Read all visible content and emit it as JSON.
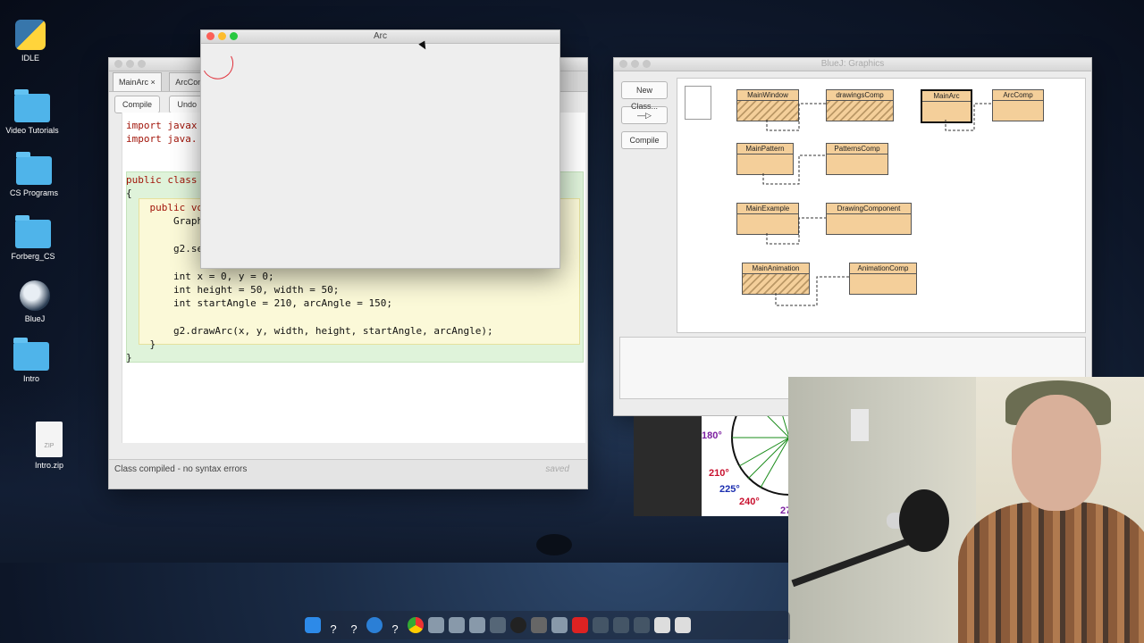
{
  "desktop": {
    "icons": [
      {
        "label": "IDLE"
      },
      {
        "label": "Video Tutorials"
      },
      {
        "label": "CS Programs"
      },
      {
        "label": "Forberg_CS"
      },
      {
        "label": "BlueJ"
      },
      {
        "label": "Intro"
      },
      {
        "label": "Intro.zip"
      }
    ],
    "zip_badge": "ZIP"
  },
  "editor": {
    "tabs": [
      {
        "label": "MainArc",
        "close": "×"
      },
      {
        "label": "ArcComp"
      }
    ],
    "toolbar": {
      "compile": "Compile",
      "undo": "Undo"
    },
    "code": [
      "import javax",
      "import java.",
      "",
      "public class",
      "{",
      "    public voi",
      "        Graphi",
      "",
      "        g2.set",
      "",
      "        int x = 0, y = 0;",
      "        int height = 50, width = 50;",
      "        int startAngle = 210, arcAngle = 150;",
      "",
      "        g2.drawArc(x, y, width, height, startAngle, arcAngle);",
      "    }",
      "}"
    ],
    "status": "Class compiled - no syntax errors",
    "saved": "saved"
  },
  "arc_window": {
    "title": "Arc"
  },
  "bluej": {
    "title": "BlueJ: Graphics",
    "buttons": {
      "new_class": "New Class...",
      "arrow": "—▷",
      "compile": "Compile"
    },
    "classes": [
      {
        "name": "MainWindow"
      },
      {
        "name": "drawingsComp"
      },
      {
        "name": "MainArc"
      },
      {
        "name": "ArcComp"
      },
      {
        "name": "MainPattern"
      },
      {
        "name": "PatternsComp"
      },
      {
        "name": "MainExample"
      },
      {
        "name": "DrawingComponent"
      },
      {
        "name": "MainAnimation"
      },
      {
        "name": "AnimationComp"
      }
    ]
  },
  "angle_diagram": {
    "labels": [
      "180°",
      "210°",
      "225°",
      "240°",
      "27"
    ],
    "colors": {
      "purple": "#7c1fa0",
      "red": "#c8102e",
      "blue": "#1c2fb0"
    }
  }
}
